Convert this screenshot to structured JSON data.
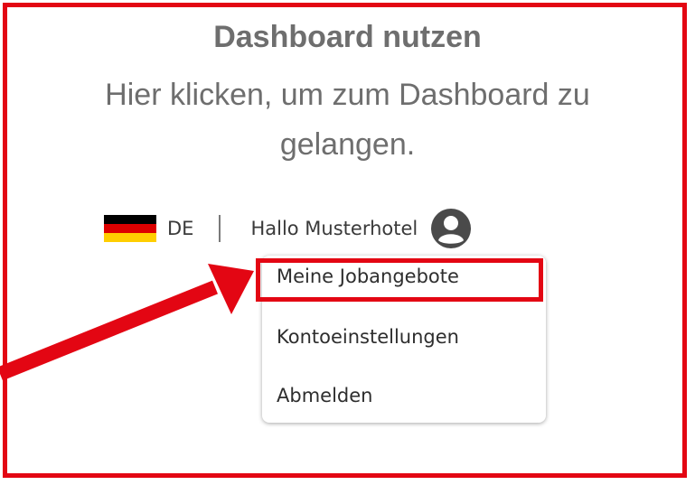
{
  "instruction": {
    "title": "Dashboard nutzen",
    "text": "Hier klicken, um zum Dashboard zu gelangen."
  },
  "header": {
    "language_flag": "germany-flag-icon",
    "language_code": "DE",
    "separator": "|",
    "greeting": "Hallo Musterhotel",
    "avatar_icon": "user-circle-icon"
  },
  "user_menu": {
    "items": [
      {
        "label": "Meine Jobangebote",
        "highlighted": true
      },
      {
        "label": "Kontoeinstellungen"
      },
      {
        "label": "Abmelden"
      }
    ]
  },
  "colors": {
    "annotation_red": "#e30613",
    "heading_gray": "#6e6e6e",
    "text_dark": "#2e2e2e",
    "flag_black": "#000000",
    "flag_red": "#dd0000",
    "flag_gold": "#ffce00"
  }
}
